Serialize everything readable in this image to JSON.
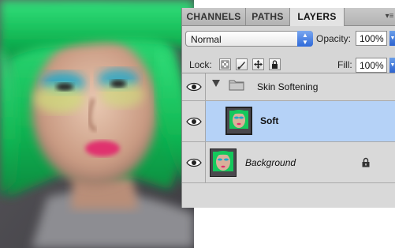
{
  "colors": {
    "panel_bg": "#d8d8d8",
    "selected_row": "#b5d2f7",
    "hair_green": "#14c85c",
    "photo_bg": "#4b4a4f"
  },
  "photo": {
    "description_icon": "portrait-photo"
  },
  "layers_panel": {
    "tabs": [
      {
        "label": "CHANNELS",
        "active": false
      },
      {
        "label": "PATHS",
        "active": false
      },
      {
        "label": "LAYERS",
        "active": true
      }
    ],
    "blend_mode": "Normal",
    "opacity_label": "Opacity:",
    "opacity_value": "100%",
    "lock_label": "Lock:",
    "lock_icons": [
      "lock-transparent-pixels-icon",
      "lock-image-pixels-icon",
      "lock-position-icon",
      "lock-all-icon"
    ],
    "fill_label": "Fill:",
    "fill_value": "100%",
    "layers": [
      {
        "name": "Skin Softening",
        "type": "group",
        "visible": true,
        "expanded": true,
        "selected": false
      },
      {
        "name": "Soft",
        "type": "layer",
        "visible": true,
        "selected": true,
        "bold": true
      },
      {
        "name": "Background",
        "type": "layer",
        "visible": true,
        "selected": false,
        "italic": true,
        "locked": true
      }
    ]
  }
}
